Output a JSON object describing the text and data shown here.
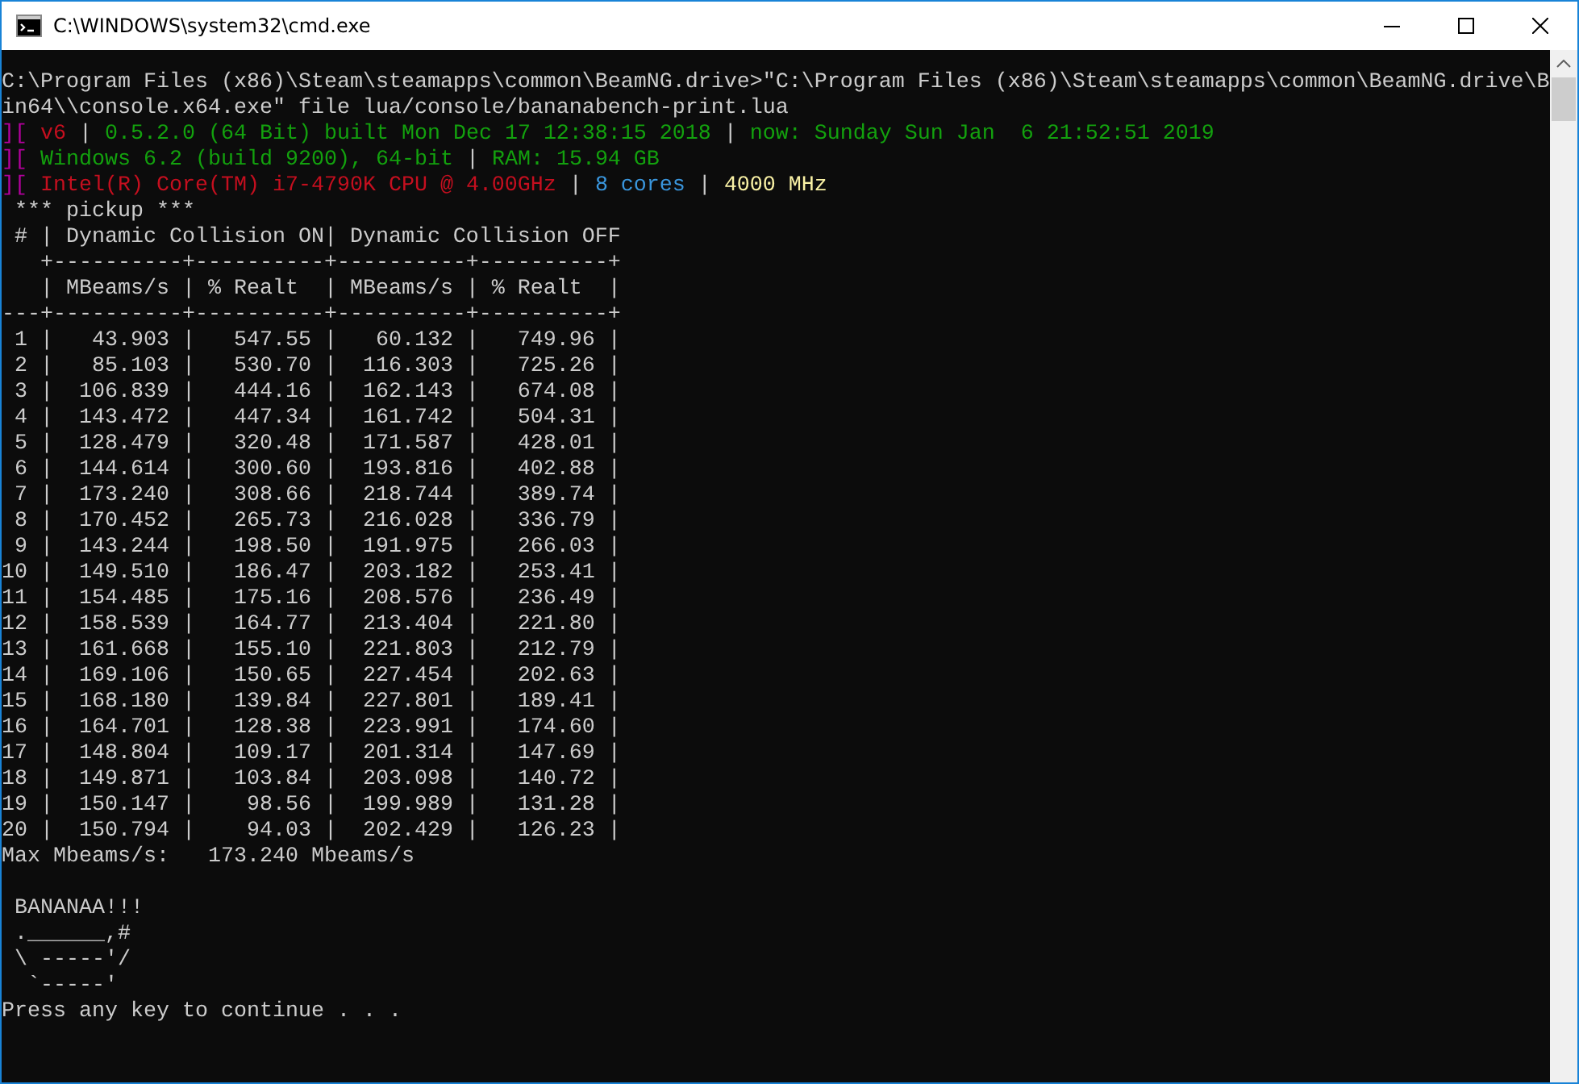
{
  "window": {
    "title": "C:\\WINDOWS\\system32\\cmd.exe"
  },
  "console": {
    "lines": [
      {
        "segments": [
          {
            "text": "C:\\Program Files (x86)\\Steam\\steamapps\\common\\BeamNG.drive>\"C:\\Program Files (x86)\\Steam\\steamapps\\common\\BeamNG.drive\\B"
          }
        ]
      },
      {
        "segments": [
          {
            "text": "in64\\\\console.x64.exe\" file lua/console/bananabench-print.lua"
          }
        ]
      },
      {
        "segments": [
          {
            "text": "][ ",
            "color": "#b4009e"
          },
          {
            "text": "v6",
            "color": "#c50f1f"
          },
          {
            "text": " | ",
            "color": "#cccccc"
          },
          {
            "text": "0.5.2.0 (64 Bit) built Mon Dec 17 12:38:15 2018",
            "color": "#13a10e"
          },
          {
            "text": " | ",
            "color": "#cccccc"
          },
          {
            "text": "now: Sunday Sun Jan  6 21:52:51 2019",
            "color": "#13a10e"
          }
        ]
      },
      {
        "segments": [
          {
            "text": "][ ",
            "color": "#b4009e"
          },
          {
            "text": "Windows 6.2 (build 9200), 64-bit",
            "color": "#13a10e"
          },
          {
            "text": " | ",
            "color": "#cccccc"
          },
          {
            "text": "RAM: 15.94 GB",
            "color": "#13a10e"
          }
        ]
      },
      {
        "segments": [
          {
            "text": "][ ",
            "color": "#b4009e"
          },
          {
            "text": "Intel(R) Core(TM) i7-4790K CPU @ 4.00GHz",
            "color": "#c50f1f"
          },
          {
            "text": " | ",
            "color": "#cccccc"
          },
          {
            "text": "8 cores",
            "color": "#3a96dd"
          },
          {
            "text": " | ",
            "color": "#cccccc"
          },
          {
            "text": "4000 MHz",
            "color": "#f9f1a5"
          }
        ]
      },
      {
        "segments": [
          {
            "text": " *** pickup ***"
          }
        ]
      },
      {
        "segments": [
          {
            "text": " # | Dynamic Collision ON| Dynamic Collision OFF"
          }
        ]
      },
      {
        "segments": [
          {
            "text": "   +----------+----------+----------+----------+"
          }
        ]
      },
      {
        "segments": [
          {
            "text": "   | MBeams/s | % Realt  | MBeams/s | % Realt  |"
          }
        ]
      },
      {
        "segments": [
          {
            "text": "---+----------+----------+----------+----------+"
          }
        ]
      },
      {
        "segments": [
          {
            "text": " 1 |   43.903 |   547.55 |   60.132 |   749.96 |"
          }
        ]
      },
      {
        "segments": [
          {
            "text": " 2 |   85.103 |   530.70 |  116.303 |   725.26 |"
          }
        ]
      },
      {
        "segments": [
          {
            "text": " 3 |  106.839 |   444.16 |  162.143 |   674.08 |"
          }
        ]
      },
      {
        "segments": [
          {
            "text": " 4 |  143.472 |   447.34 |  161.742 |   504.31 |"
          }
        ]
      },
      {
        "segments": [
          {
            "text": " 5 |  128.479 |   320.48 |  171.587 |   428.01 |"
          }
        ]
      },
      {
        "segments": [
          {
            "text": " 6 |  144.614 |   300.60 |  193.816 |   402.88 |"
          }
        ]
      },
      {
        "segments": [
          {
            "text": " 7 |  173.240 |   308.66 |  218.744 |   389.74 |"
          }
        ]
      },
      {
        "segments": [
          {
            "text": " 8 |  170.452 |   265.73 |  216.028 |   336.79 |"
          }
        ]
      },
      {
        "segments": [
          {
            "text": " 9 |  143.244 |   198.50 |  191.975 |   266.03 |"
          }
        ]
      },
      {
        "segments": [
          {
            "text": "10 |  149.510 |   186.47 |  203.182 |   253.41 |"
          }
        ]
      },
      {
        "segments": [
          {
            "text": "11 |  154.485 |   175.16 |  208.576 |   236.49 |"
          }
        ]
      },
      {
        "segments": [
          {
            "text": "12 |  158.539 |   164.77 |  213.404 |   221.80 |"
          }
        ]
      },
      {
        "segments": [
          {
            "text": "13 |  161.668 |   155.10 |  221.803 |   212.79 |"
          }
        ]
      },
      {
        "segments": [
          {
            "text": "14 |  169.106 |   150.65 |  227.454 |   202.63 |"
          }
        ]
      },
      {
        "segments": [
          {
            "text": "15 |  168.180 |   139.84 |  227.801 |   189.41 |"
          }
        ]
      },
      {
        "segments": [
          {
            "text": "16 |  164.701 |   128.38 |  223.991 |   174.60 |"
          }
        ]
      },
      {
        "segments": [
          {
            "text": "17 |  148.804 |   109.17 |  201.314 |   147.69 |"
          }
        ]
      },
      {
        "segments": [
          {
            "text": "18 |  149.871 |   103.84 |  203.098 |   140.72 |"
          }
        ]
      },
      {
        "segments": [
          {
            "text": "19 |  150.147 |    98.56 |  199.989 |   131.28 |"
          }
        ]
      },
      {
        "segments": [
          {
            "text": "20 |  150.794 |    94.03 |  202.429 |   126.23 |"
          }
        ]
      },
      {
        "segments": [
          {
            "text": "Max Mbeams/s:   173.240 Mbeams/s"
          }
        ]
      },
      {
        "blank_before": true,
        "segments": [
          {
            "text": " BANANAA!!!"
          }
        ]
      },
      {
        "segments": [
          {
            "text": " .______,#"
          }
        ]
      },
      {
        "segments": [
          {
            "text": " \\ -----'/"
          }
        ]
      },
      {
        "segments": [
          {
            "text": "  `-----'"
          }
        ]
      },
      {
        "segments": [
          {
            "text": "Press any key to continue . . ."
          }
        ]
      }
    ]
  }
}
